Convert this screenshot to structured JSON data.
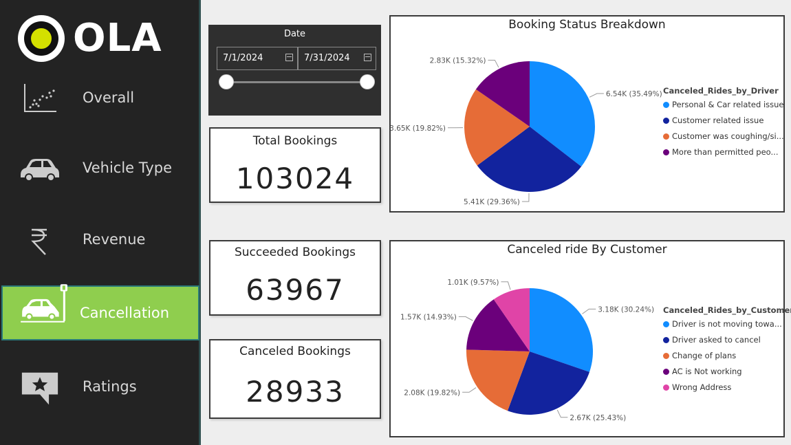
{
  "app": {
    "logo_text": "OLA"
  },
  "sidebar": {
    "items": [
      {
        "label": "Overall",
        "icon": "scatter-chart-icon"
      },
      {
        "label": "Vehicle Type",
        "icon": "car-icon"
      },
      {
        "label": "Revenue",
        "icon": "rupee-icon"
      },
      {
        "label": "Cancellation",
        "icon": "car-crash-icon",
        "active": true
      },
      {
        "label": "Ratings",
        "icon": "star-comment-icon"
      }
    ]
  },
  "date_slicer": {
    "title": "Date",
    "start": "7/1/2024",
    "end": "7/31/2024"
  },
  "kpis": {
    "total": {
      "title": "Total Bookings",
      "value": "103024"
    },
    "succeeded": {
      "title": "Succeeded Bookings",
      "value": "63967"
    },
    "canceled": {
      "title": "Canceled Bookings",
      "value": "28933"
    }
  },
  "colors": {
    "accent": "#8fce4e",
    "sidebar_bg": "#232323",
    "blue": "#118dff",
    "navy": "#12239e",
    "orange": "#e66c37",
    "purple": "#6b007b",
    "pink": "#e044a7"
  },
  "chart_data": [
    {
      "type": "pie",
      "title": "Booking Status Breakdown",
      "legend_title": "Canceled_Rides_by_Driver",
      "legend_placement": "right",
      "slices": [
        {
          "label": "Personal & Car related issue",
          "value": 6.54,
          "pct": 35.49,
          "data_label": "6.54K (35.49%)",
          "color": "#118dff"
        },
        {
          "label": "Customer related issue",
          "value": 5.41,
          "pct": 29.36,
          "data_label": "5.41K (29.36%)",
          "color": "#12239e"
        },
        {
          "label": "Customer was coughing/si...",
          "value": 3.65,
          "pct": 19.82,
          "data_label": "3.65K (19.82%)",
          "color": "#e66c37"
        },
        {
          "label": "More than permitted peo...",
          "value": 2.83,
          "pct": 15.32,
          "data_label": "2.83K (15.32%)",
          "color": "#6b007b"
        }
      ]
    },
    {
      "type": "pie",
      "title": "Canceled ride By Customer",
      "legend_title": "Canceled_Rides_by_Customer",
      "legend_placement": "right",
      "slices": [
        {
          "label": "Driver is not moving towa...",
          "value": 3.18,
          "pct": 30.24,
          "data_label": "3.18K (30.24%)",
          "color": "#118dff"
        },
        {
          "label": "Driver asked to cancel",
          "value": 2.67,
          "pct": 25.43,
          "data_label": "2.67K (25.43%)",
          "color": "#12239e"
        },
        {
          "label": "Change of plans",
          "value": 2.08,
          "pct": 19.82,
          "data_label": "2.08K (19.82%)",
          "color": "#e66c37"
        },
        {
          "label": "AC is Not working",
          "value": 1.57,
          "pct": 14.93,
          "data_label": "1.57K (14.93%)",
          "color": "#6b007b"
        },
        {
          "label": "Wrong Address",
          "value": 1.01,
          "pct": 9.57,
          "data_label": "1.01K (9.57%)",
          "color": "#e044a7"
        }
      ]
    }
  ]
}
